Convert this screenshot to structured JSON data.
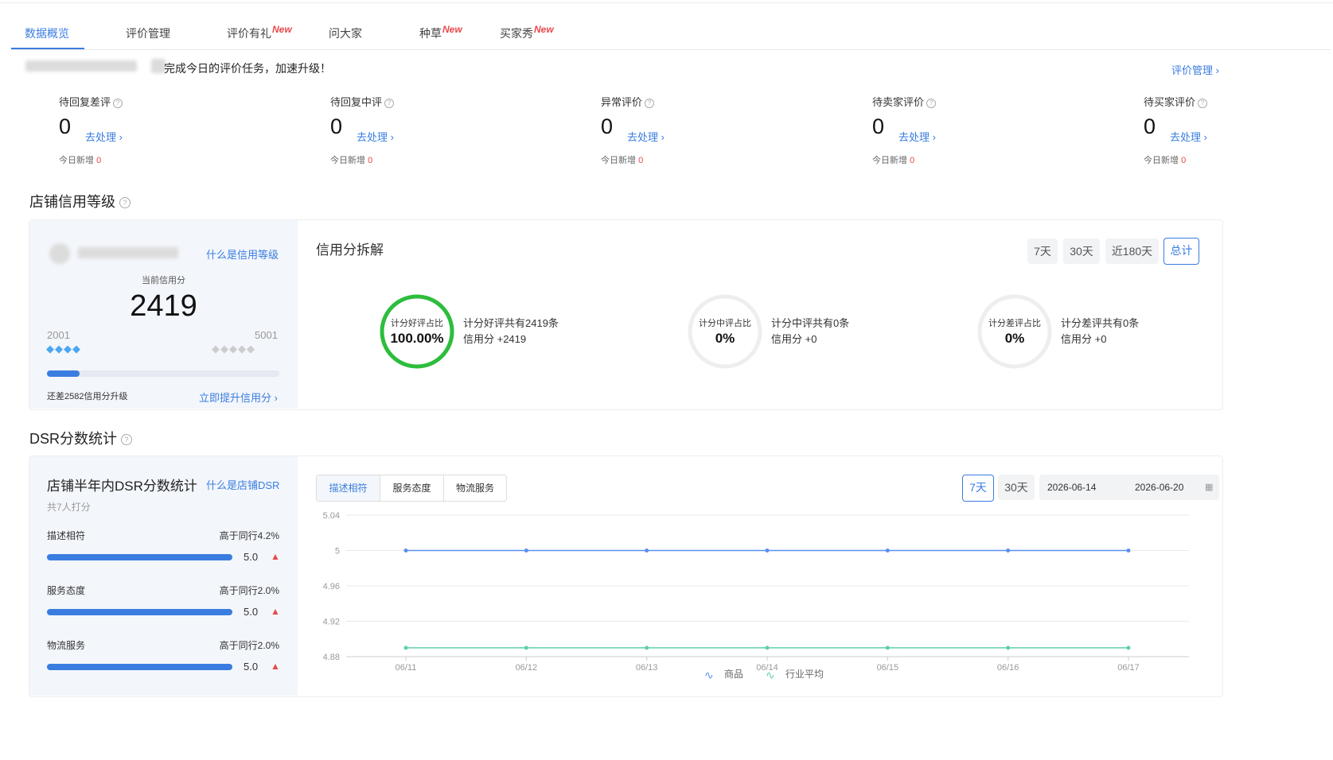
{
  "tabs": [
    {
      "label": "数据概览",
      "new": false,
      "active": true
    },
    {
      "label": "评价管理",
      "new": false,
      "active": false
    },
    {
      "label": "评价有礼",
      "new": true,
      "active": false
    },
    {
      "label": "问大家",
      "new": false,
      "active": false
    },
    {
      "label": "种草",
      "new": true,
      "active": false
    },
    {
      "label": "买家秀",
      "new": true,
      "active": false
    }
  ],
  "new_tag": "New",
  "task_banner": "完成今日的评价任务，加速升级！",
  "review_manage_link": "评价管理 ›",
  "stats": [
    {
      "label": "待回复差评",
      "value": "0",
      "action": "去处理 ›",
      "sub": "今日新增",
      "sub_value": "0"
    },
    {
      "label": "待回复中评",
      "value": "0",
      "action": "去处理 ›",
      "sub": "今日新增",
      "sub_value": "0"
    },
    {
      "label": "异常评价",
      "value": "0",
      "action": "去处理 ›",
      "sub": "今日新增",
      "sub_value": "0"
    },
    {
      "label": "待卖家评价",
      "value": "0",
      "action": "去处理 ›",
      "sub": "今日新增",
      "sub_value": "0"
    },
    {
      "label": "待买家评价",
      "value": "0",
      "action": "去处理 ›",
      "sub": "今日新增",
      "sub_value": "0"
    }
  ],
  "credit": {
    "section_title": "店铺信用等级",
    "what_link": "什么是信用等级",
    "current_label": "当前信用分",
    "score": "2419",
    "range_min": "2001",
    "range_max": "5001",
    "progress": 0.14,
    "remaining_text": "还差2582信用分升级",
    "improve_link": "立即提升信用分 ›"
  },
  "breakdown": {
    "title": "信用分拆解",
    "periods": [
      "7天",
      "30天",
      "近180天",
      "总计"
    ],
    "active_period": "总计",
    "items": [
      {
        "ring_label": "计分好评占比",
        "ratio": "100.00%",
        "ratio_value": 1.0,
        "color": "#2dbd3c",
        "desc1": "计分好评共有2419条",
        "desc2": "信用分 +2419"
      },
      {
        "ring_label": "计分中评占比",
        "ratio": "0%",
        "ratio_value": 0,
        "color": "#2dbd3c",
        "desc1": "计分中评共有0条",
        "desc2": "信用分 +0"
      },
      {
        "ring_label": "计分差评占比",
        "ratio": "0%",
        "ratio_value": 0,
        "color": "#2dbd3c",
        "desc1": "计分差评共有0条",
        "desc2": "信用分 +0"
      }
    ]
  },
  "dsr": {
    "section_title": "DSR分数统计",
    "card_title": "店铺半年内DSR分数统计",
    "what_link": "什么是店铺DSR",
    "raters": "共7人打分",
    "items": [
      {
        "label": "描述相符",
        "compare": "高于同行4.2%",
        "score": "5.0",
        "arrow": "▲"
      },
      {
        "label": "服务态度",
        "compare": "高于同行2.0%",
        "score": "5.0",
        "arrow": "▲"
      },
      {
        "label": "物流服务",
        "compare": "高于同行2.0%",
        "score": "5.0",
        "arrow": "▲"
      }
    ],
    "chart_tabs": [
      "描述相符",
      "服务态度",
      "物流服务"
    ],
    "active_chart_tab": "描述相符",
    "periods": [
      "7天",
      "30天"
    ],
    "active_period": "7天",
    "date_start": "2026-06-14",
    "date_end": "2026-06-20",
    "calendar_icon": "calendar-icon"
  },
  "colors": {
    "accent": "#3a7de0",
    "red": "#e8484a",
    "green": "#2dbd3c",
    "teal": "#5fd0a8"
  },
  "chart_data": {
    "type": "line",
    "x": [
      "06/11",
      "06/12",
      "06/13",
      "06/14",
      "06/15",
      "06/16",
      "06/17"
    ],
    "y_ticks": [
      "5.04",
      "5",
      "4.96",
      "4.92",
      "4.88"
    ],
    "ylim": [
      4.88,
      5.04
    ],
    "series": [
      {
        "name": "商品",
        "color": "#5b8ff0",
        "values": [
          5,
          5,
          5,
          5,
          5,
          5,
          5
        ]
      },
      {
        "name": "行业平均",
        "color": "#5fd0a8",
        "values": [
          4.89,
          4.89,
          4.89,
          4.89,
          4.89,
          4.89,
          4.89
        ]
      }
    ],
    "grid": true,
    "legend": "bottom-center"
  }
}
